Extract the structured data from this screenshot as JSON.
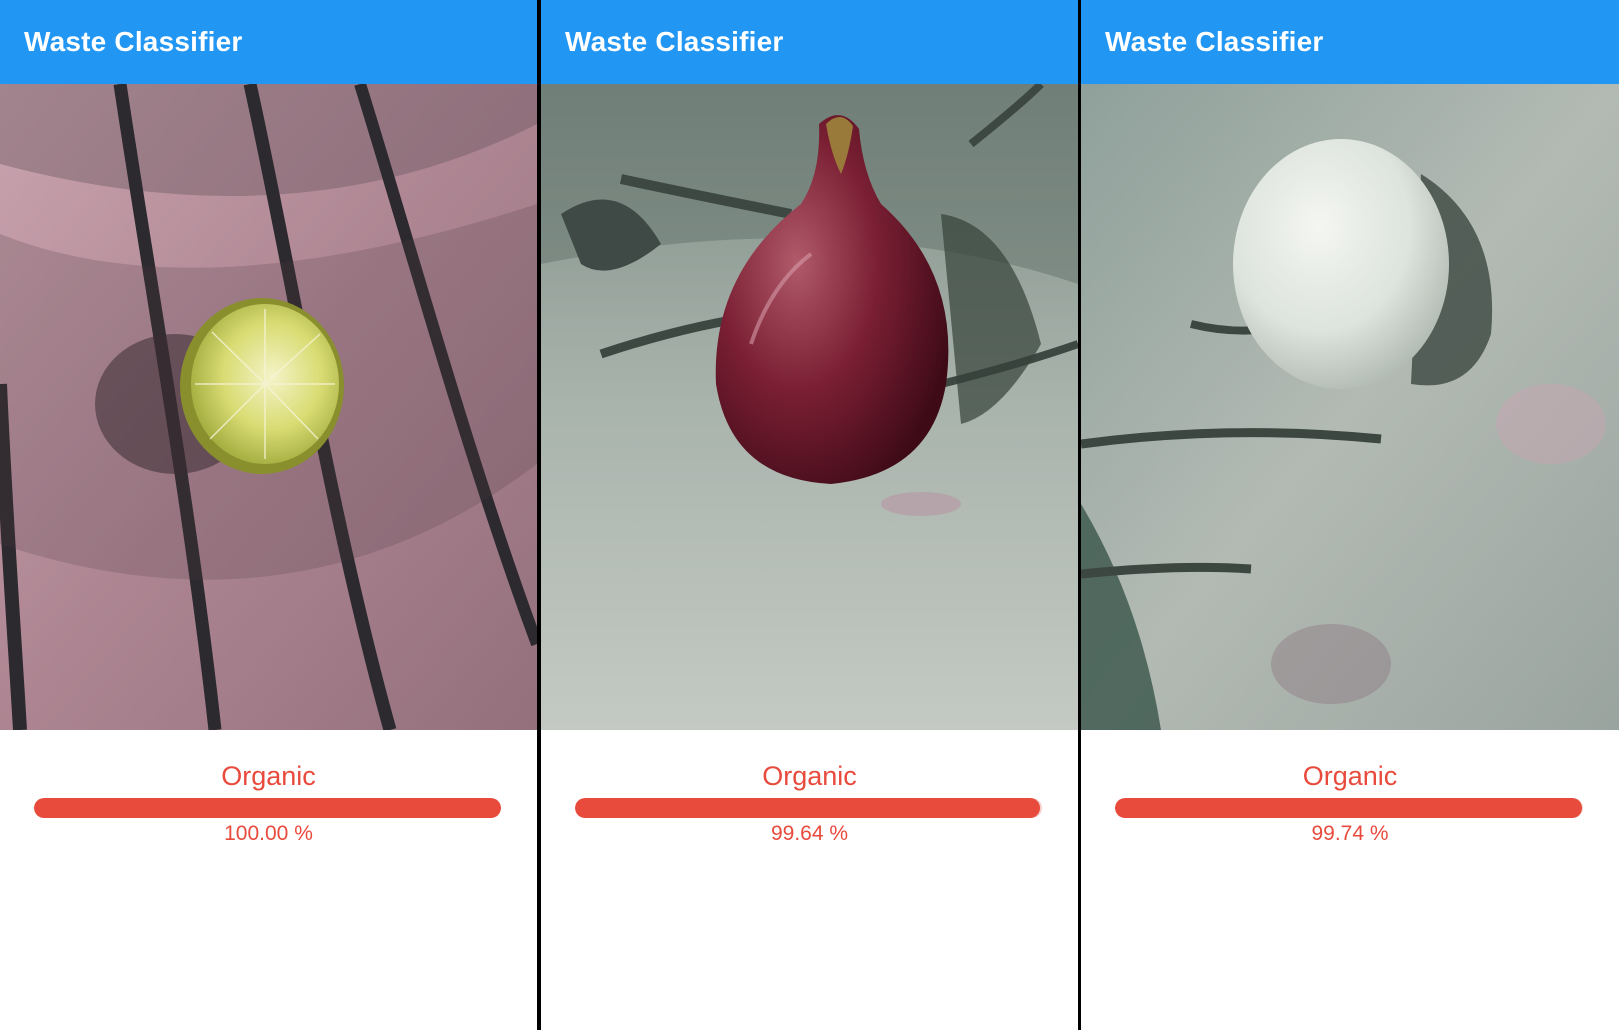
{
  "theme": {
    "appbar_color": "#2196f3",
    "result_color": "#e84a3c"
  },
  "panels": [
    {
      "app_title": "Waste Classifier",
      "subject": "lime-half-photo",
      "result": {
        "label": "Organic",
        "percent_text": "100.00 %",
        "confidence": 1.0
      }
    },
    {
      "app_title": "Waste Classifier",
      "subject": "red-onion-photo",
      "result": {
        "label": "Organic",
        "percent_text": "99.64 %",
        "confidence": 0.9964
      }
    },
    {
      "app_title": "Waste Classifier",
      "subject": "egg-photo",
      "result": {
        "label": "Organic",
        "percent_text": "99.74 %",
        "confidence": 0.9974
      }
    }
  ]
}
